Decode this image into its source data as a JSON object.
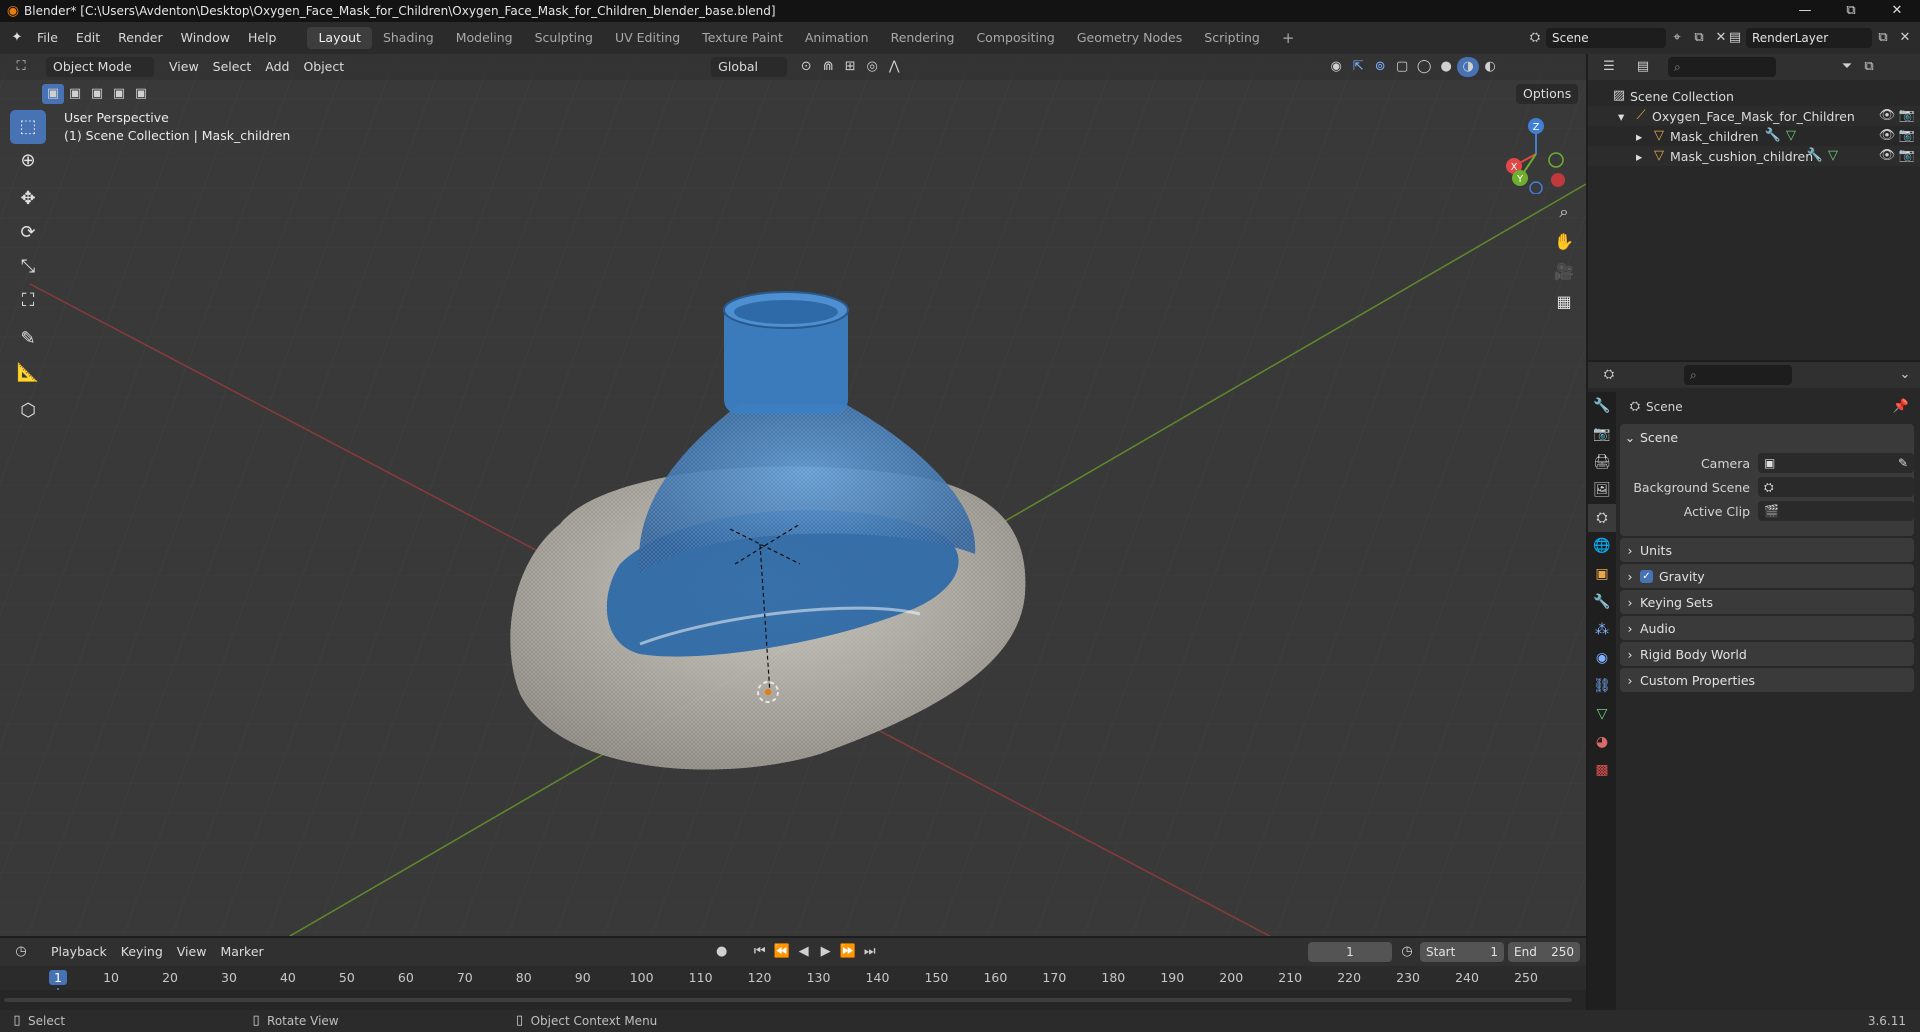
{
  "window": {
    "title": "Blender* [C:\\Users\\Avdenton\\Desktop\\Oxygen_Face_Mask_for_Children\\Oxygen_Face_Mask_for_Children_blender_base.blend]",
    "minimize": "—",
    "maximize": "⧉",
    "close": "✕"
  },
  "menubar": {
    "items": [
      "File",
      "Edit",
      "Render",
      "Window",
      "Help"
    ],
    "workspaces": [
      "Layout",
      "Shading",
      "Modeling",
      "Sculpting",
      "UV Editing",
      "Texture Paint",
      "Animation",
      "Rendering",
      "Compositing",
      "Geometry Nodes",
      "Scripting"
    ],
    "active_workspace": "Layout",
    "add_workspace": "+",
    "scene_name": "Scene",
    "view_layer": "RenderLayer"
  },
  "viewport": {
    "mode": "Object Mode",
    "menus": [
      "View",
      "Select",
      "Add",
      "Object"
    ],
    "transform_orientation": "Global",
    "options_label": "Options",
    "overlay_title": "User Perspective",
    "overlay_subtitle": "(1) Scene Collection | Mask_children",
    "gizmo": {
      "x": "X",
      "y": "Y",
      "z": "Z"
    }
  },
  "outliner": {
    "root": "Scene Collection",
    "collection": "Oxygen_Face_Mask_for_Children",
    "objects": [
      "Mask_children",
      "Mask_cushion_children"
    ]
  },
  "properties": {
    "context_title": "Scene",
    "panel_scene": "Scene",
    "camera_label": "Camera",
    "background_label": "Background Scene",
    "active_clip_label": "Active Clip",
    "subpanels": [
      "Units",
      "Gravity",
      "Keying Sets",
      "Audio",
      "Rigid Body World",
      "Custom Properties"
    ],
    "gravity_checked": true
  },
  "timeline": {
    "menus": [
      "Playback",
      "Keying",
      "View",
      "Marker"
    ],
    "current_frame": "1",
    "start_label": "Start",
    "start_value": "1",
    "end_label": "End",
    "end_value": "250",
    "ticks": [
      "1",
      "10",
      "20",
      "30",
      "40",
      "50",
      "60",
      "70",
      "80",
      "90",
      "100",
      "110",
      "120",
      "130",
      "140",
      "150",
      "160",
      "170",
      "180",
      "190",
      "200",
      "210",
      "220",
      "230",
      "240",
      "250"
    ]
  },
  "statusbar": {
    "select": "Select",
    "rotate": "Rotate View",
    "context_menu": "Object Context Menu",
    "version": "3.6.11"
  },
  "colors": {
    "accent": "#4772b3",
    "x_axis": "#e04848",
    "y_axis": "#6fae2e",
    "z_axis": "#3f7fd6",
    "mask_blue": "#3b78b8",
    "cushion": "#b8b4ac"
  }
}
